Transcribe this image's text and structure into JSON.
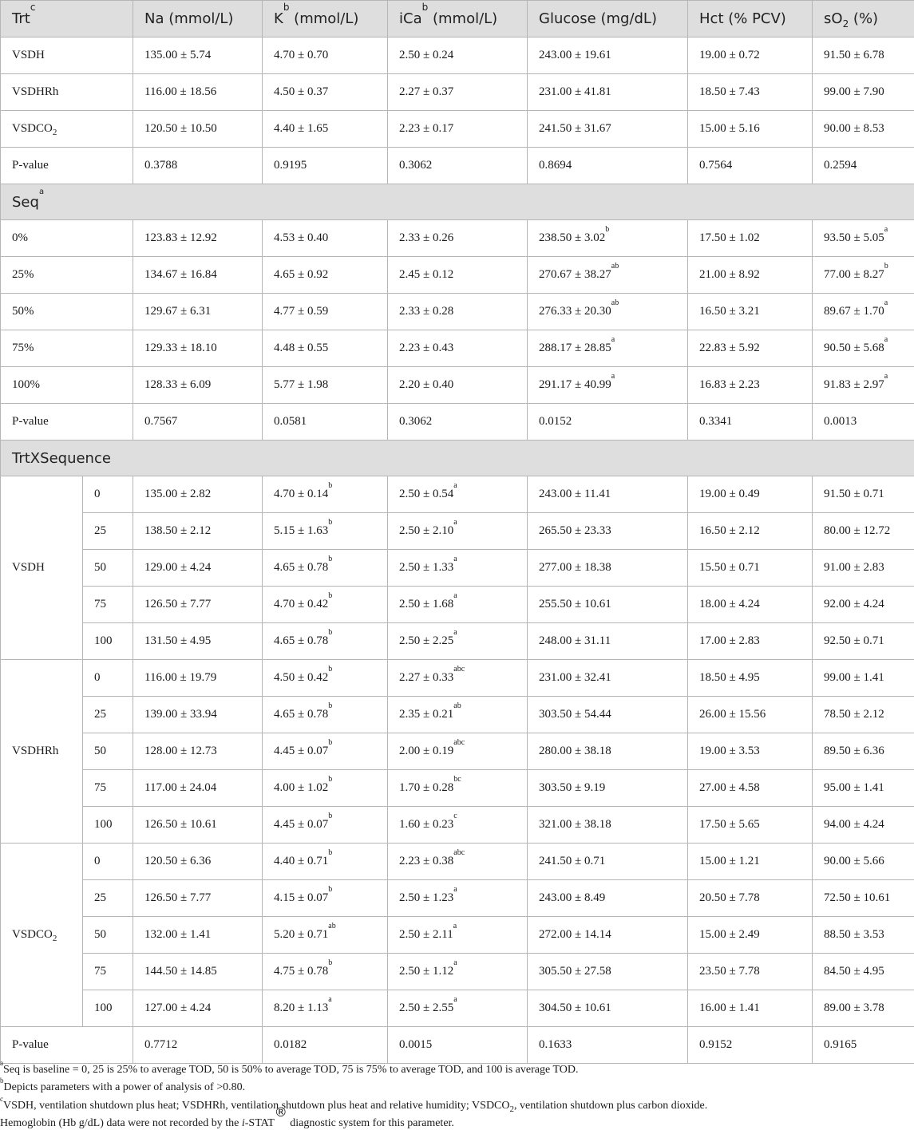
{
  "header": {
    "trt": "Trt",
    "trt_sup": "c",
    "na": "Na (mmol/L)",
    "k": "K",
    "k_sup": "b",
    "k_unit": " (mmol/L)",
    "ica": "iCa",
    "ica_sup": "b",
    "ica_unit": " (mmol/L)",
    "glucose": "Glucose (mg/dL)",
    "hct": "Hct (% PCV)",
    "so2_pre": "sO",
    "so2_sub": "2",
    "so2_post": " (%)"
  },
  "trt_rows": [
    {
      "label": "VSDH",
      "na": "135.00 ± 5.74",
      "k": "4.70 ± 0.70",
      "ica": "2.50 ± 0.24",
      "glucose": "243.00 ± 19.61",
      "hct": "19.00 ± 0.72",
      "so2": "91.50 ± 6.78"
    },
    {
      "label": "VSDHRh",
      "na": "116.00 ± 18.56",
      "k": "4.50 ± 0.37",
      "ica": "2.27 ± 0.37",
      "glucose": "231.00 ± 41.81",
      "hct": "18.50 ± 7.43",
      "so2": "99.00 ± 7.90"
    },
    {
      "label": "VSDCO",
      "label_sub": "2",
      "na": "120.50 ± 10.50",
      "k": "4.40 ± 1.65",
      "ica": "2.23 ± 0.17",
      "glucose": "241.50 ± 31.67",
      "hct": "15.00 ± 5.16",
      "so2": "90.00 ± 8.53"
    },
    {
      "label": "P-value",
      "na": "0.3788",
      "k": "0.9195",
      "ica": "0.3062",
      "glucose": "0.8694",
      "hct": "0.7564",
      "so2": "0.2594"
    }
  ],
  "seq_section": {
    "title": "Seq",
    "title_sup": "a"
  },
  "seq_rows": [
    {
      "label": "0%",
      "na": "123.83 ± 12.92",
      "k": "4.53 ± 0.40",
      "ica": "2.33 ± 0.26",
      "glucose": "238.50 ± 3.02",
      "glucose_sup": "b",
      "hct": "17.50 ± 1.02",
      "so2": "93.50 ± 5.05",
      "so2_sup": "a"
    },
    {
      "label": "25%",
      "na": "134.67 ± 16.84",
      "k": "4.65 ± 0.92",
      "ica": "2.45 ± 0.12",
      "glucose": "270.67 ± 38.27",
      "glucose_sup": "ab",
      "hct": "21.00 ± 8.92",
      "so2": "77.00 ± 8.27",
      "so2_sup": "b"
    },
    {
      "label": "50%",
      "na": "129.67 ± 6.31",
      "k": "4.77 ± 0.59",
      "ica": "2.33 ± 0.28",
      "glucose": "276.33 ± 20.30",
      "glucose_sup": "ab",
      "hct": "16.50 ± 3.21",
      "so2": "89.67 ± 1.70",
      "so2_sup": "a"
    },
    {
      "label": "75%",
      "na": "129.33 ± 18.10",
      "k": "4.48 ± 0.55",
      "ica": "2.23 ± 0.43",
      "glucose": "288.17 ± 28.85",
      "glucose_sup": "a",
      "hct": "22.83 ± 5.92",
      "so2": "90.50 ± 5.68",
      "so2_sup": "a"
    },
    {
      "label": "100%",
      "na": "128.33 ± 6.09",
      "k": "5.77 ± 1.98",
      "ica": "2.20 ± 0.40",
      "glucose": "291.17 ± 40.99",
      "glucose_sup": "a",
      "hct": "16.83 ± 2.23",
      "so2": "91.83 ± 2.97",
      "so2_sup": "a"
    },
    {
      "label": "P-value",
      "na": "0.7567",
      "k": "0.0581",
      "ica": "0.3062",
      "glucose": "0.0152",
      "hct": "0.3341",
      "so2": "0.0013"
    }
  ],
  "txs_section": {
    "title": "TrtXSequence"
  },
  "groups": [
    {
      "label": "VSDH",
      "rows": [
        {
          "seq": "0",
          "na": "135.00 ± 2.82",
          "k": "4.70 ± 0.14",
          "k_sup": "b",
          "ica": "2.50 ± 0.54",
          "ica_sup": "a",
          "glucose": "243.00 ± 11.41",
          "hct": "19.00 ± 0.49",
          "so2": "91.50 ± 0.71"
        },
        {
          "seq": "25",
          "na": "138.50 ± 2.12",
          "k": "5.15 ± 1.63",
          "k_sup": "b",
          "ica": "2.50 ± 2.10",
          "ica_sup": "a",
          "glucose": "265.50 ± 23.33",
          "hct": "16.50 ± 2.12",
          "so2": "80.00 ± 12.72"
        },
        {
          "seq": "50",
          "na": "129.00 ± 4.24",
          "k": "4.65 ± 0.78",
          "k_sup": "b",
          "ica": "2.50 ± 1.33",
          "ica_sup": "a",
          "glucose": "277.00 ± 18.38",
          "hct": "15.50 ± 0.71",
          "so2": "91.00 ± 2.83"
        },
        {
          "seq": "75",
          "na": "126.50 ± 7.77",
          "k": "4.70 ± 0.42",
          "k_sup": "b",
          "ica": "2.50 ± 1.68",
          "ica_sup": "a",
          "glucose": "255.50 ± 10.61",
          "hct": "18.00 ± 4.24",
          "so2": "92.00 ± 4.24"
        },
        {
          "seq": "100",
          "na": "131.50 ± 4.95",
          "k": "4.65 ± 0.78",
          "k_sup": "b",
          "ica": "2.50 ± 2.25",
          "ica_sup": "a",
          "glucose": "248.00 ± 31.11",
          "hct": "17.00 ± 2.83",
          "so2": "92.50 ± 0.71"
        }
      ]
    },
    {
      "label": "VSDHRh",
      "rows": [
        {
          "seq": "0",
          "na": "116.00 ± 19.79",
          "k": "4.50 ± 0.42",
          "k_sup": "b",
          "ica": "2.27 ± 0.33",
          "ica_sup": "abc",
          "glucose": "231.00 ± 32.41",
          "hct": "18.50 ± 4.95",
          "so2": "99.00 ± 1.41"
        },
        {
          "seq": "25",
          "na": "139.00 ± 33.94",
          "k": "4.65 ± 0.78",
          "k_sup": "b",
          "ica": "2.35 ± 0.21",
          "ica_sup": "ab",
          "glucose": "303.50 ± 54.44",
          "hct": "26.00 ± 15.56",
          "so2": "78.50 ± 2.12"
        },
        {
          "seq": "50",
          "na": "128.00 ± 12.73",
          "k": "4.45 ± 0.07",
          "k_sup": "b",
          "ica": "2.00 ± 0.19",
          "ica_sup": "abc",
          "glucose": "280.00 ± 38.18",
          "hct": "19.00 ± 3.53",
          "so2": "89.50 ± 6.36"
        },
        {
          "seq": "75",
          "na": "117.00 ± 24.04",
          "k": "4.00 ± 1.02",
          "k_sup": "b",
          "ica": "1.70 ± 0.28",
          "ica_sup": "bc",
          "glucose": "303.50 ± 9.19",
          "hct": "27.00 ± 4.58",
          "so2": "95.00 ± 1.41"
        },
        {
          "seq": "100",
          "na": "126.50 ± 10.61",
          "k": "4.45 ± 0.07",
          "k_sup": "b",
          "ica": "1.60 ± 0.23",
          "ica_sup": "c",
          "glucose": "321.00 ± 38.18",
          "hct": "17.50 ± 5.65",
          "so2": "94.00 ± 4.24"
        }
      ]
    },
    {
      "label": "VSDCO",
      "label_sub": "2",
      "rows": [
        {
          "seq": "0",
          "na": "120.50 ± 6.36",
          "k": "4.40 ± 0.71",
          "k_sup": "b",
          "ica": "2.23 ± 0.38",
          "ica_sup": "abc",
          "glucose": "241.50 ± 0.71",
          "hct": "15.00 ± 1.21",
          "so2": "90.00 ± 5.66"
        },
        {
          "seq": "25",
          "na": "126.50 ± 7.77",
          "k": "4.15 ± 0.07",
          "k_sup": "b",
          "ica": "2.50 ± 1.23",
          "ica_sup": "a",
          "glucose": "243.00 ± 8.49",
          "hct": "20.50 ± 7.78",
          "so2": "72.50 ± 10.61"
        },
        {
          "seq": "50",
          "na": "132.00 ± 1.41",
          "k": "5.20 ± 0.71",
          "k_sup": "ab",
          "ica": "2.50 ± 2.11",
          "ica_sup": "a",
          "glucose": "272.00 ± 14.14",
          "hct": "15.00 ± 2.49",
          "so2": "88.50 ± 3.53"
        },
        {
          "seq": "75",
          "na": "144.50 ± 14.85",
          "k": "4.75 ± 0.78",
          "k_sup": "b",
          "ica": "2.50 ± 1.12",
          "ica_sup": "a",
          "glucose": "305.50 ± 27.58",
          "hct": "23.50 ± 7.78",
          "so2": "84.50 ± 4.95"
        },
        {
          "seq": "100",
          "na": "127.00 ± 4.24",
          "k": "8.20 ± 1.13",
          "k_sup": "a",
          "ica": "2.50 ± 2.55",
          "ica_sup": "a",
          "glucose": "304.50 ± 10.61",
          "hct": "16.00 ± 1.41",
          "so2": "89.00 ± 3.78"
        }
      ]
    }
  ],
  "txs_pvalue": {
    "label": "P-value",
    "na": "0.7712",
    "k": "0.0182",
    "ica": "0.0015",
    "glucose": "0.1633",
    "hct": "0.9152",
    "so2": "0.9165"
  },
  "footnotes": {
    "a_sup": "a",
    "a": "Seq is baseline = 0, 25 is 25% to average TOD, 50 is 50% to average TOD, 75 is 75% to average TOD, and 100 is average TOD.",
    "b_sup": "b",
    "b": "Depicts parameters with a power of analysis of >0.80.",
    "c_sup": "c",
    "c_pre": "VSDH, ventilation shutdown plus heat; VSDHRh, ventilation shutdown plus heat and relative humidity; VSDCO",
    "c_sub": "2",
    "c_post": ", ventilation shutdown plus carbon dioxide.",
    "d_pre": "Hemoglobin (Hb g/dL) data were not recorded by the ",
    "d_italic": "i",
    "d_mid": "-STAT",
    "d_reg": "®",
    "d_post": "  diagnostic system for this parameter."
  }
}
